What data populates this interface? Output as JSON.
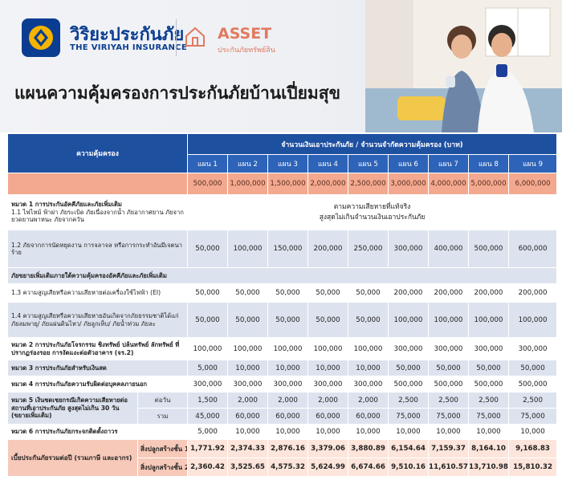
{
  "brand": {
    "th": "วิริยะประกันภัย",
    "en": "THE VIRIYAH INSURANCE",
    "asset_name": "ASSET",
    "asset_sub": "ประกันภัยทรัพย์สิน"
  },
  "page_title": "แผนความคุ้มครองการประกันภัยบ้านเปี่ยมสุข",
  "table": {
    "coverage_header": "ความคุ้มครอง",
    "amount_header": "จำนวนเงินเอาประกันภัย / จำนวนจำกัดความคุ้มครอง (บาท)",
    "plans": [
      "แผน 1",
      "แผน 2",
      "แผน 3",
      "แผน 4",
      "แผน 5",
      "แผน 6",
      "แผน 7",
      "แผน 8",
      "แผน 9"
    ],
    "sums_insured": [
      "500,000",
      "1,000,000",
      "1,500,000",
      "2,000,000",
      "2,500,000",
      "3,000,000",
      "4,000,000",
      "5,000,000",
      "6,000,000"
    ],
    "section1_label": "หมวด 1 การประกันอัคคีภัยและภัยเพิ่มเติม",
    "section1_items": "1.1 ไฟไหม้ ฟ้าผ่า ภัยระเบิด ภัยเนื่องจากน้ำ ภัยอากาศยาน ภัยจากยวดยานพาหนะ ภัยจากควัน",
    "section1_value_line1": "ตามความเสียหายที่แท้จริง",
    "section1_value_line2": "สูงสุดไม่เกินจำนวนเงินเอาประกันภัย",
    "rows_a": [
      {
        "label": "1.2 ภัยจากการนัดหยุดงาน การจลาจล หรือการกระทำอันมีเจตนาร้าย",
        "values": [
          "50,000",
          "100,000",
          "150,000",
          "200,000",
          "250,000",
          "300,000",
          "400,000",
          "500,000",
          "600,000"
        ]
      }
    ],
    "extension_label": "ภัยขยายเพิ่มเติมภายใต้ความคุ้มครองอัคคีภัยและภัยเพิ่มเติม",
    "rows_b": [
      {
        "label": "1.3 ความสูญเสียหรือความเสียหายต่อเครื่องใช้ไฟฟ้า (EI)",
        "values": [
          "50,000",
          "50,000",
          "50,000",
          "50,000",
          "50,000",
          "200,000",
          "200,000",
          "200,000",
          "200,000"
        ]
      },
      {
        "label": "1.4 ความสูญเสียหรือความเสียหายอันเกิดจากภัยธรรมชาติได้แก่ ภัยลมพายุ/ ภัยแผ่นดินไหว/ ภัยลูกเห็บ/ ภัยน้ำท่วม ภัยละ",
        "values": [
          "50,000",
          "50,000",
          "50,000",
          "50,000",
          "50,000",
          "100,000",
          "100,000",
          "100,000",
          "100,000"
        ]
      },
      {
        "label": "หมวด 2 การประกันภัยโจรกรรม ชิงทรัพย์ ปล้นทรัพย์ ลักทรัพย์ ที่ปรากฏร่องรอย การงัดแงะต่อตัวอาคาร (จร.2)",
        "values": [
          "100,000",
          "100,000",
          "100,000",
          "100,000",
          "100,000",
          "300,000",
          "300,000",
          "300,000",
          "300,000"
        ]
      },
      {
        "label": "หมวด 3 การประกันภัยสำหรับเงินสด",
        "values": [
          "5,000",
          "10,000",
          "10,000",
          "10,000",
          "10,000",
          "50,000",
          "50,000",
          "50,000",
          "50,000"
        ]
      },
      {
        "label": "หมวด 4 การประกันภัยความรับผิดต่อบุคคลภายนอก",
        "values": [
          "300,000",
          "300,000",
          "300,000",
          "300,000",
          "300,000",
          "500,000",
          "500,000",
          "500,000",
          "500,000"
        ]
      }
    ],
    "section5": {
      "label": "หมวด 5 เงินชดเชยกรณีเกิดความเสียหายต่อสถานที่เอาประกันภัย สูงสุดไม่เกิน 30 วัน (ขยายเพิ่มเติม)",
      "per_day_label": "ต่อวัน",
      "total_label": "รวม",
      "per_day": [
        "1,500",
        "2,000",
        "2,000",
        "2,000",
        "2,000",
        "2,500",
        "2,500",
        "2,500",
        "2,500"
      ],
      "total": [
        "45,000",
        "60,000",
        "60,000",
        "60,000",
        "60,000",
        "75,000",
        "75,000",
        "75,000",
        "75,000"
      ]
    },
    "section6": {
      "label": "หมวด 6 การประกันภัยกระจกติดตั้งถาวร",
      "values": [
        "5,000",
        "10,000",
        "10,000",
        "10,000",
        "10,000",
        "10,000",
        "10,000",
        "10,000",
        "10,000"
      ]
    },
    "premium": {
      "label": "เบี้ยประกันภัยรวมต่อปี (รวมภาษี และอากร)",
      "row1_label": "สิ่งปลูกสร้างชั้น 1",
      "row2_label": "สิ่งปลูกสร้างชั้น 2",
      "row1": [
        "1,771.92",
        "2,374.33",
        "2,876.16",
        "3,379.06",
        "3,880.89",
        "6,154.64",
        "7,159.37",
        "8,164.10",
        "9,168.83"
      ],
      "row2": [
        "2,360.42",
        "3,525.65",
        "4,575.32",
        "5,624.99",
        "6,674.66",
        "9,510.16",
        "11,610.57",
        "13,710.98",
        "15,810.32"
      ]
    }
  }
}
